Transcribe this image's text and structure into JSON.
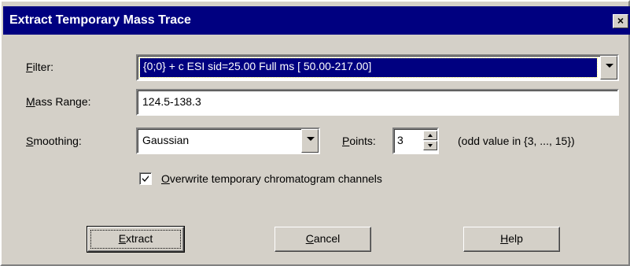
{
  "window": {
    "title": "Extract Temporary Mass Trace",
    "close_label": "×"
  },
  "filter": {
    "label_first": "F",
    "label_rest": "ilter:",
    "value": "{0;0} + c ESI sid=25.00  Full ms [ 50.00-217.00]"
  },
  "mass_range": {
    "label_first": "M",
    "label_rest": "ass Range:",
    "value": "124.5-138.3"
  },
  "smoothing": {
    "label_first": "S",
    "label_rest": "moothing:",
    "value": "Gaussian"
  },
  "points": {
    "label_first": "P",
    "label_rest": "oints:",
    "value": "3",
    "hint": "(odd value in {3, ..., 15})"
  },
  "overwrite": {
    "label_first": "O",
    "label_rest": "verwrite temporary chromatogram channels",
    "checked": true
  },
  "buttons": {
    "extract_first": "E",
    "extract_rest": "xtract",
    "cancel_first": "C",
    "cancel_rest": "ancel",
    "help_first": "H",
    "help_rest": "elp"
  }
}
